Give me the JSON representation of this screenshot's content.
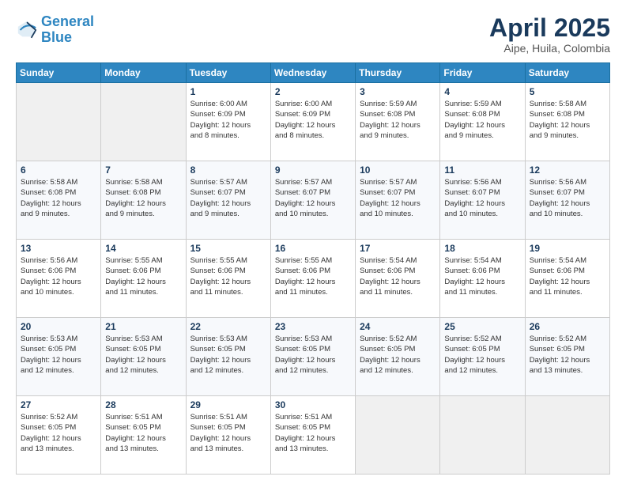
{
  "header": {
    "logo_line1": "General",
    "logo_line2": "Blue",
    "title": "April 2025",
    "subtitle": "Aipe, Huila, Colombia"
  },
  "calendar": {
    "days_of_week": [
      "Sunday",
      "Monday",
      "Tuesday",
      "Wednesday",
      "Thursday",
      "Friday",
      "Saturday"
    ],
    "weeks": [
      [
        {
          "num": "",
          "info": ""
        },
        {
          "num": "",
          "info": ""
        },
        {
          "num": "1",
          "info": "Sunrise: 6:00 AM\nSunset: 6:09 PM\nDaylight: 12 hours\nand 8 minutes."
        },
        {
          "num": "2",
          "info": "Sunrise: 6:00 AM\nSunset: 6:09 PM\nDaylight: 12 hours\nand 8 minutes."
        },
        {
          "num": "3",
          "info": "Sunrise: 5:59 AM\nSunset: 6:08 PM\nDaylight: 12 hours\nand 9 minutes."
        },
        {
          "num": "4",
          "info": "Sunrise: 5:59 AM\nSunset: 6:08 PM\nDaylight: 12 hours\nand 9 minutes."
        },
        {
          "num": "5",
          "info": "Sunrise: 5:58 AM\nSunset: 6:08 PM\nDaylight: 12 hours\nand 9 minutes."
        }
      ],
      [
        {
          "num": "6",
          "info": "Sunrise: 5:58 AM\nSunset: 6:08 PM\nDaylight: 12 hours\nand 9 minutes."
        },
        {
          "num": "7",
          "info": "Sunrise: 5:58 AM\nSunset: 6:08 PM\nDaylight: 12 hours\nand 9 minutes."
        },
        {
          "num": "8",
          "info": "Sunrise: 5:57 AM\nSunset: 6:07 PM\nDaylight: 12 hours\nand 9 minutes."
        },
        {
          "num": "9",
          "info": "Sunrise: 5:57 AM\nSunset: 6:07 PM\nDaylight: 12 hours\nand 10 minutes."
        },
        {
          "num": "10",
          "info": "Sunrise: 5:57 AM\nSunset: 6:07 PM\nDaylight: 12 hours\nand 10 minutes."
        },
        {
          "num": "11",
          "info": "Sunrise: 5:56 AM\nSunset: 6:07 PM\nDaylight: 12 hours\nand 10 minutes."
        },
        {
          "num": "12",
          "info": "Sunrise: 5:56 AM\nSunset: 6:07 PM\nDaylight: 12 hours\nand 10 minutes."
        }
      ],
      [
        {
          "num": "13",
          "info": "Sunrise: 5:56 AM\nSunset: 6:06 PM\nDaylight: 12 hours\nand 10 minutes."
        },
        {
          "num": "14",
          "info": "Sunrise: 5:55 AM\nSunset: 6:06 PM\nDaylight: 12 hours\nand 11 minutes."
        },
        {
          "num": "15",
          "info": "Sunrise: 5:55 AM\nSunset: 6:06 PM\nDaylight: 12 hours\nand 11 minutes."
        },
        {
          "num": "16",
          "info": "Sunrise: 5:55 AM\nSunset: 6:06 PM\nDaylight: 12 hours\nand 11 minutes."
        },
        {
          "num": "17",
          "info": "Sunrise: 5:54 AM\nSunset: 6:06 PM\nDaylight: 12 hours\nand 11 minutes."
        },
        {
          "num": "18",
          "info": "Sunrise: 5:54 AM\nSunset: 6:06 PM\nDaylight: 12 hours\nand 11 minutes."
        },
        {
          "num": "19",
          "info": "Sunrise: 5:54 AM\nSunset: 6:06 PM\nDaylight: 12 hours\nand 11 minutes."
        }
      ],
      [
        {
          "num": "20",
          "info": "Sunrise: 5:53 AM\nSunset: 6:05 PM\nDaylight: 12 hours\nand 12 minutes."
        },
        {
          "num": "21",
          "info": "Sunrise: 5:53 AM\nSunset: 6:05 PM\nDaylight: 12 hours\nand 12 minutes."
        },
        {
          "num": "22",
          "info": "Sunrise: 5:53 AM\nSunset: 6:05 PM\nDaylight: 12 hours\nand 12 minutes."
        },
        {
          "num": "23",
          "info": "Sunrise: 5:53 AM\nSunset: 6:05 PM\nDaylight: 12 hours\nand 12 minutes."
        },
        {
          "num": "24",
          "info": "Sunrise: 5:52 AM\nSunset: 6:05 PM\nDaylight: 12 hours\nand 12 minutes."
        },
        {
          "num": "25",
          "info": "Sunrise: 5:52 AM\nSunset: 6:05 PM\nDaylight: 12 hours\nand 12 minutes."
        },
        {
          "num": "26",
          "info": "Sunrise: 5:52 AM\nSunset: 6:05 PM\nDaylight: 12 hours\nand 13 minutes."
        }
      ],
      [
        {
          "num": "27",
          "info": "Sunrise: 5:52 AM\nSunset: 6:05 PM\nDaylight: 12 hours\nand 13 minutes."
        },
        {
          "num": "28",
          "info": "Sunrise: 5:51 AM\nSunset: 6:05 PM\nDaylight: 12 hours\nand 13 minutes."
        },
        {
          "num": "29",
          "info": "Sunrise: 5:51 AM\nSunset: 6:05 PM\nDaylight: 12 hours\nand 13 minutes."
        },
        {
          "num": "30",
          "info": "Sunrise: 5:51 AM\nSunset: 6:05 PM\nDaylight: 12 hours\nand 13 minutes."
        },
        {
          "num": "",
          "info": ""
        },
        {
          "num": "",
          "info": ""
        },
        {
          "num": "",
          "info": ""
        }
      ]
    ]
  }
}
